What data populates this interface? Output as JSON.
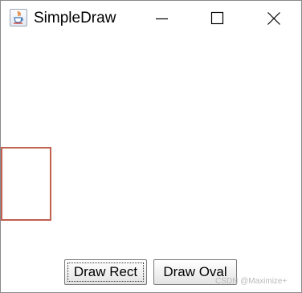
{
  "window": {
    "title": "SimpleDraw",
    "app_icon": "java-cup-icon"
  },
  "controls": {
    "minimize_icon": "minimize-icon",
    "maximize_icon": "maximize-icon",
    "close_icon": "close-icon"
  },
  "canvas": {
    "shape_color": "#c0604e"
  },
  "buttons": {
    "draw_rect_label": "Draw Rect",
    "draw_oval_label": "Draw Oval"
  },
  "watermark": {
    "text": "CSDN @Maximize+"
  }
}
